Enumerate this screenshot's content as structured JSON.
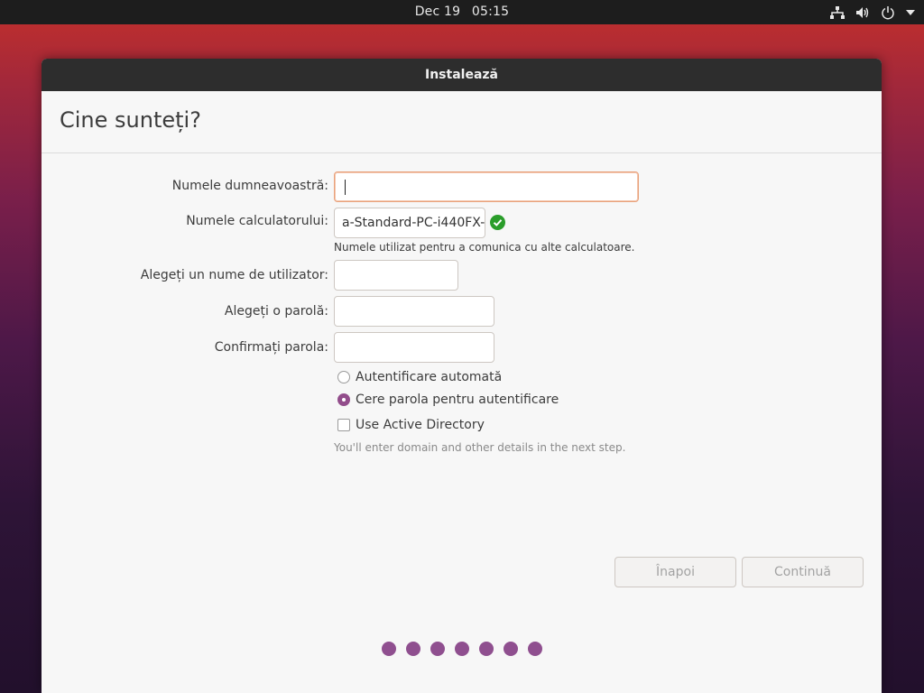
{
  "topbar": {
    "date": "Dec 19",
    "time": "05:15",
    "icons": [
      "network-icon",
      "volume-icon",
      "power-icon",
      "menu-arrow-icon"
    ]
  },
  "window": {
    "title": "Instalează"
  },
  "page": {
    "heading": "Cine sunteți?"
  },
  "form": {
    "name_label": "Numele dumneavoastră:",
    "name_value": "",
    "computer_label": "Numele calculatorului:",
    "computer_value": "a-Standard-PC-i440FX-",
    "computer_hint": "Numele utilizat pentru a comunica cu alte calculatoare.",
    "username_label": "Alegeți un nume de utilizator:",
    "username_value": "",
    "password_label": "Alegeți o parolă:",
    "password_value": "",
    "confirm_label": "Confirmați parola:",
    "confirm_value": "",
    "auto_login": "Autentificare automată",
    "require_password": "Cere parola pentru autentificare",
    "selected_login_option": "require_password",
    "active_directory": "Use Active Directory",
    "active_directory_checked": false,
    "active_directory_hint": "You'll enter domain and other details in the next step."
  },
  "buttons": {
    "back": "Înapoi",
    "continue": "Continuă"
  },
  "progress": {
    "dots": 7
  },
  "colors": {
    "accent": "#924d8b",
    "focus_border": "#e9a27c",
    "valid_green": "#2a9d2a"
  }
}
